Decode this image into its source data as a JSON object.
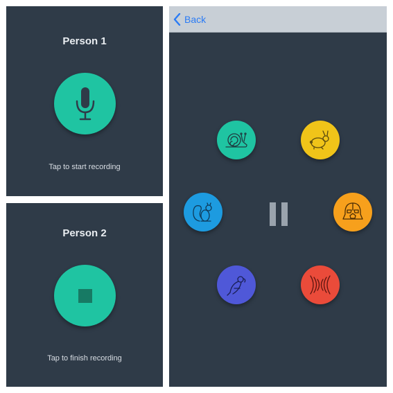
{
  "person1": {
    "title": "Person 1",
    "caption": "Tap to start recording",
    "button_icon": "microphone-icon",
    "button_color": "#1fc4a2"
  },
  "person2": {
    "title": "Person 2",
    "caption": "Tap to finish recording",
    "button_icon": "stop-icon",
    "button_color": "#1fc4a2"
  },
  "player": {
    "back_label": "Back",
    "back_icon": "chevron-left-icon",
    "pause_icon": "pause-icon",
    "effects": [
      {
        "name": "snail",
        "icon": "snail-icon",
        "color": "#1fc4a2"
      },
      {
        "name": "rabbit",
        "icon": "rabbit-icon",
        "color": "#f0c419"
      },
      {
        "name": "squirrel",
        "icon": "squirrel-icon",
        "color": "#1d9be0"
      },
      {
        "name": "darth-vader",
        "icon": "darth-vader-helmet-icon",
        "color": "#f7a01c"
      },
      {
        "name": "parrot",
        "icon": "parrot-icon",
        "color": "#4f58d8"
      },
      {
        "name": "echo",
        "icon": "echo-waves-icon",
        "color": "#ea4b3a"
      }
    ]
  }
}
